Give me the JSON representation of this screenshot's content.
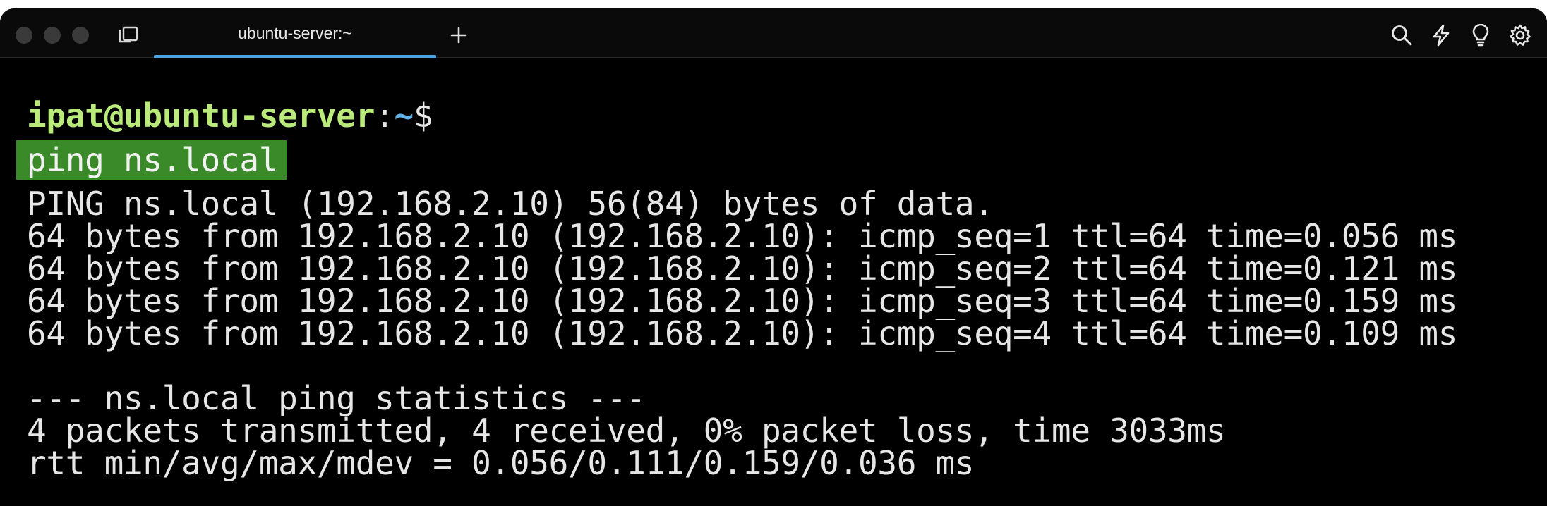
{
  "tabs": [
    {
      "label": "ubuntu-server:~",
      "active": true
    }
  ],
  "prompt": {
    "user_host": "ipat@ubuntu-server",
    "colon": ":",
    "path": "~",
    "symbol": "$"
  },
  "command": "ping ns.local",
  "output": {
    "header": "PING ns.local (192.168.2.10) 56(84) bytes of data.",
    "replies": [
      "64 bytes from 192.168.2.10 (192.168.2.10): icmp_seq=1 ttl=64 time=0.056 ms",
      "64 bytes from 192.168.2.10 (192.168.2.10): icmp_seq=2 ttl=64 time=0.121 ms",
      "64 bytes from 192.168.2.10 (192.168.2.10): icmp_seq=3 ttl=64 time=0.159 ms",
      "64 bytes from 192.168.2.10 (192.168.2.10): icmp_seq=4 ttl=64 time=0.109 ms"
    ],
    "stats_title": "--- ns.local ping statistics ---",
    "stats_summary": "4 packets transmitted, 4 received, 0% packet loss, time 3033ms",
    "stats_rtt": "rtt min/avg/max/mdev = 0.056/0.111/0.159/0.036 ms"
  },
  "colors": {
    "background": "#000000",
    "prompt_user": "#b9ea7a",
    "prompt_path": "#5fb3e8",
    "command_highlight": "#3a8a2a",
    "tab_accent": "#4aa3df"
  },
  "icons": [
    "layout-icon",
    "plus-icon",
    "search-icon",
    "bolt-icon",
    "lightbulb-icon",
    "gear-icon"
  ]
}
